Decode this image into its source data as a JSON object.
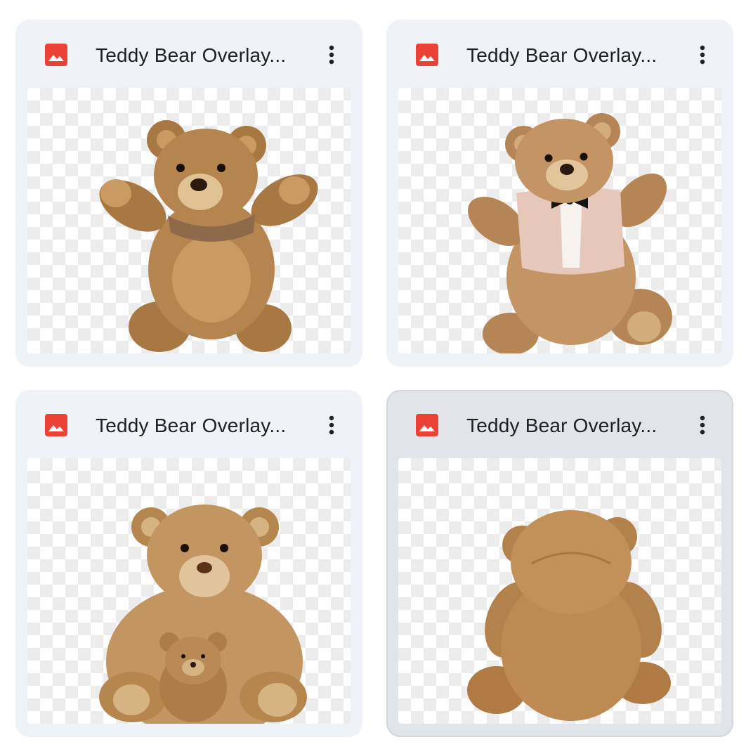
{
  "files": [
    {
      "name": "Teddy Bear Overlay...",
      "type_icon": "image-icon",
      "menu_icon": "more-vert-icon",
      "selected": false
    },
    {
      "name": "Teddy Bear Overlay...",
      "type_icon": "image-icon",
      "menu_icon": "more-vert-icon",
      "selected": false
    },
    {
      "name": "Teddy Bear Overlay...",
      "type_icon": "image-icon",
      "menu_icon": "more-vert-icon",
      "selected": false
    },
    {
      "name": "Teddy Bear Overlay...",
      "type_icon": "image-icon",
      "menu_icon": "more-vert-icon",
      "selected": true
    }
  ],
  "colors": {
    "card_bg": "#eff2f6",
    "card_selected_bg": "#e1e4e9",
    "image_icon": "#ea4335",
    "title_text": "#1f1f1f",
    "bear_fur": "#b5854f",
    "bear_dark": "#8a5a2e",
    "bear_light": "#d9b585"
  }
}
